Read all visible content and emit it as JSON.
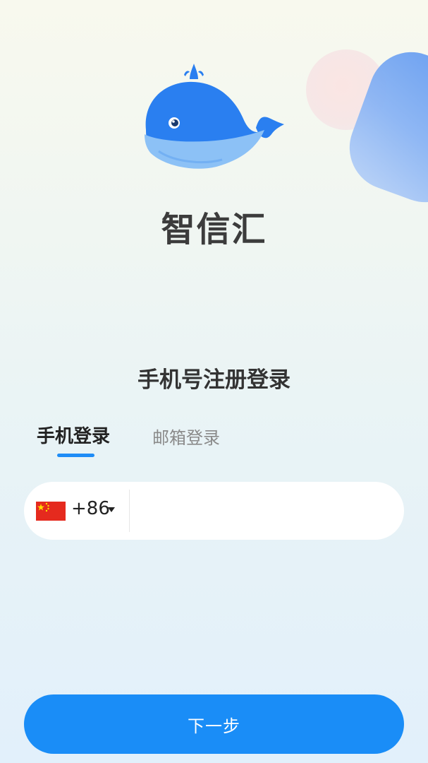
{
  "app": {
    "name": "智信汇",
    "logo_icon": "whale-icon"
  },
  "login": {
    "title": "手机号注册登录",
    "tabs": [
      {
        "label": "手机登录",
        "active": true
      },
      {
        "label": "邮箱登录",
        "active": false
      }
    ],
    "country_flag": "china-flag-icon",
    "country_code": "+86",
    "phone_value": "",
    "next_label": "下一步"
  },
  "colors": {
    "accent": "#1a8df7",
    "tab_indicator": "#1e8cf6"
  }
}
